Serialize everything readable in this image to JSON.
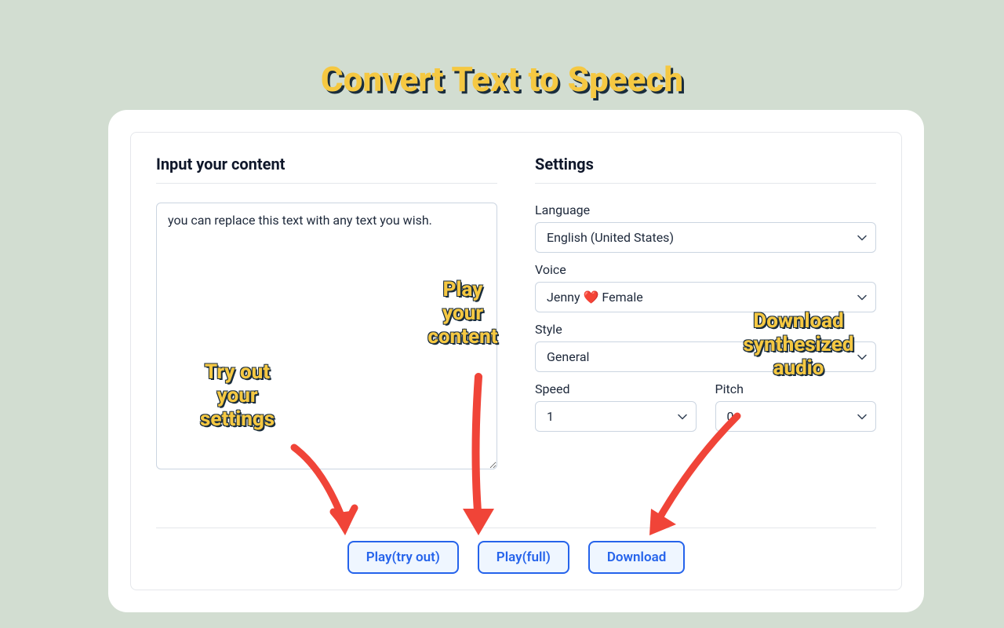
{
  "title": "Convert Text to Speech",
  "input": {
    "header": "Input your content",
    "textarea_value": "you can replace this text with any text you wish."
  },
  "settings": {
    "header": "Settings",
    "language": {
      "label": "Language",
      "value": "English (United States)"
    },
    "voice": {
      "label": "Voice",
      "value": "Jenny ❤️ Female"
    },
    "style": {
      "label": "Style",
      "value": "General"
    },
    "speed": {
      "label": "Speed",
      "value": "1"
    },
    "pitch": {
      "label": "Pitch",
      "value": "0"
    }
  },
  "buttons": {
    "play_tryout": "Play(try out)",
    "play_full": "Play(full)",
    "download": "Download"
  },
  "annotations": {
    "tryout": "Try out\nyour\nsettings",
    "play": "Play\nyour\ncontent",
    "download": "Download\nsynthesized\naudio"
  }
}
